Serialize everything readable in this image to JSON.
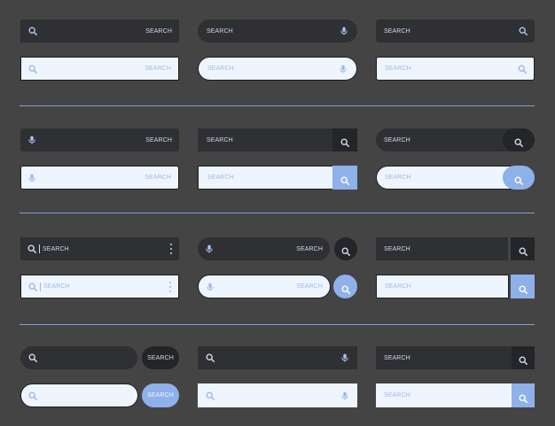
{
  "search_label": "SEARCH",
  "icons": {
    "search": "search-icon",
    "mic": "mic-icon",
    "menu": "more-vertical-icon"
  },
  "colors": {
    "background": "#444444",
    "dark_bar": "#2f3033",
    "light_bar": "#eef5ff",
    "accent": "#8eb1ea",
    "text_light": "#cfd8ea",
    "text_accent": "#9fb8e6"
  }
}
